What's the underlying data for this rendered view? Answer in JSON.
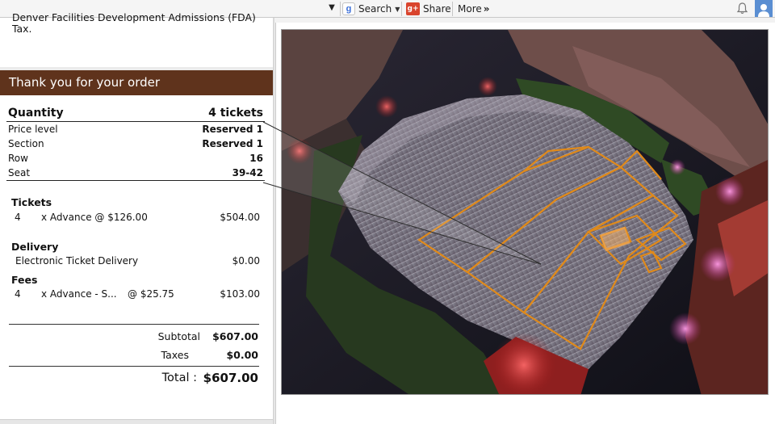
{
  "toolbar": {
    "search_label": "Search",
    "share_label": "Share",
    "more_label": "More",
    "more_chevron": "»"
  },
  "tax_note": "Denver Facilities Development Admissions (FDA) Tax.",
  "order": {
    "banner": "Thank you for your order",
    "quantity_label": "Quantity",
    "quantity_value": "4 tickets",
    "details": [
      {
        "label": "Price level",
        "value": "Reserved 1"
      },
      {
        "label": "Section",
        "value": "Reserved 1"
      },
      {
        "label": "Row",
        "value": "16"
      },
      {
        "label": "Seat",
        "value": "39-42"
      }
    ]
  },
  "tickets": {
    "title": "Tickets",
    "qty": "4",
    "desc": "x Advance @ $126.00",
    "amount": "$504.00"
  },
  "delivery": {
    "title": "Delivery",
    "desc": "Electronic Ticket Delivery",
    "amount": "$0.00"
  },
  "fees": {
    "title": "Fees",
    "qty": "4",
    "desc": "x Advance - S...",
    "unit": "@ $25.75",
    "amount": "$103.00"
  },
  "summary": {
    "subtotal_label": "Subtotal",
    "subtotal_value": "$607.00",
    "taxes_label": "Taxes",
    "taxes_value": "$0.00",
    "total_label": "Total :",
    "total_value": "$607.00"
  },
  "colors": {
    "banner": "#5f331c",
    "section_outline": "#e08a1a",
    "user_button": "#5a8ed2"
  }
}
